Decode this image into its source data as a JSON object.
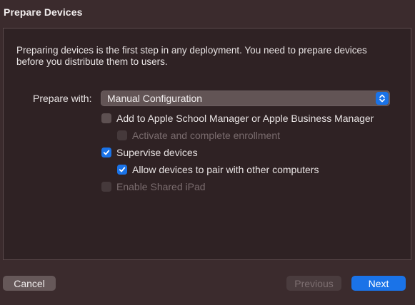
{
  "dialog": {
    "title": "Prepare Devices",
    "intro": "Preparing devices is the first step in any deployment. You need to prepare devices before you distribute them to users."
  },
  "prepare_with": {
    "label": "Prepare with:",
    "selected": "Manual Configuration",
    "icon": "chevron-updown-icon"
  },
  "options": {
    "add_to_manager": {
      "label": "Add to Apple School Manager or Apple Business Manager",
      "checked": false,
      "enabled": true
    },
    "activate_enrollment": {
      "label": "Activate and complete enrollment",
      "checked": false,
      "enabled": false
    },
    "supervise": {
      "label": "Supervise devices",
      "checked": true,
      "enabled": true
    },
    "allow_pair": {
      "label": "Allow devices to pair with other computers",
      "checked": true,
      "enabled": true
    },
    "shared_ipad": {
      "label": "Enable Shared iPad",
      "checked": false,
      "enabled": false
    }
  },
  "buttons": {
    "cancel": "Cancel",
    "previous": "Previous",
    "next": "Next"
  },
  "colors": {
    "accent": "#1a73e8",
    "background": "#3b2b2d",
    "panel": "#2f2224"
  }
}
